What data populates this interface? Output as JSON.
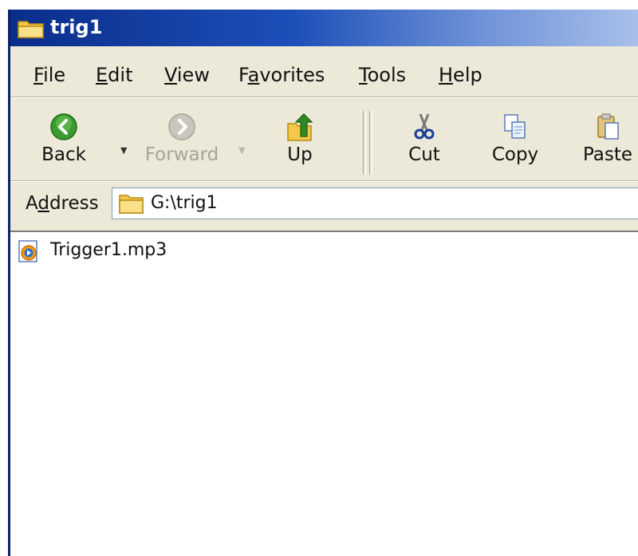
{
  "window": {
    "title": "trig1"
  },
  "menubar": {
    "items": [
      {
        "pre": "",
        "accel": "F",
        "post": "ile"
      },
      {
        "pre": "",
        "accel": "E",
        "post": "dit"
      },
      {
        "pre": "",
        "accel": "V",
        "post": "iew"
      },
      {
        "pre": "F",
        "accel": "a",
        "post": "vorites"
      },
      {
        "pre": "",
        "accel": "T",
        "post": "ools"
      },
      {
        "pre": "",
        "accel": "H",
        "post": "elp"
      }
    ]
  },
  "toolbar": {
    "back_label": "Back",
    "forward_label": "Forward",
    "up_label": "Up",
    "cut_label": "Cut",
    "copy_label": "Copy",
    "paste_label": "Paste"
  },
  "address": {
    "label_pre": "A",
    "label_accel": "d",
    "label_post": "dress",
    "path": "G:\\trig1"
  },
  "files": [
    {
      "name": "Trigger1.mp3",
      "icon": "media-file-icon"
    }
  ],
  "colors": {
    "titlebar_start": "#0a2d8a",
    "titlebar_end": "#a9c0ea",
    "chrome": "#ece9d8",
    "back_icon_green": "#3a9b2e",
    "up_icon_green": "#2f8a1f"
  }
}
